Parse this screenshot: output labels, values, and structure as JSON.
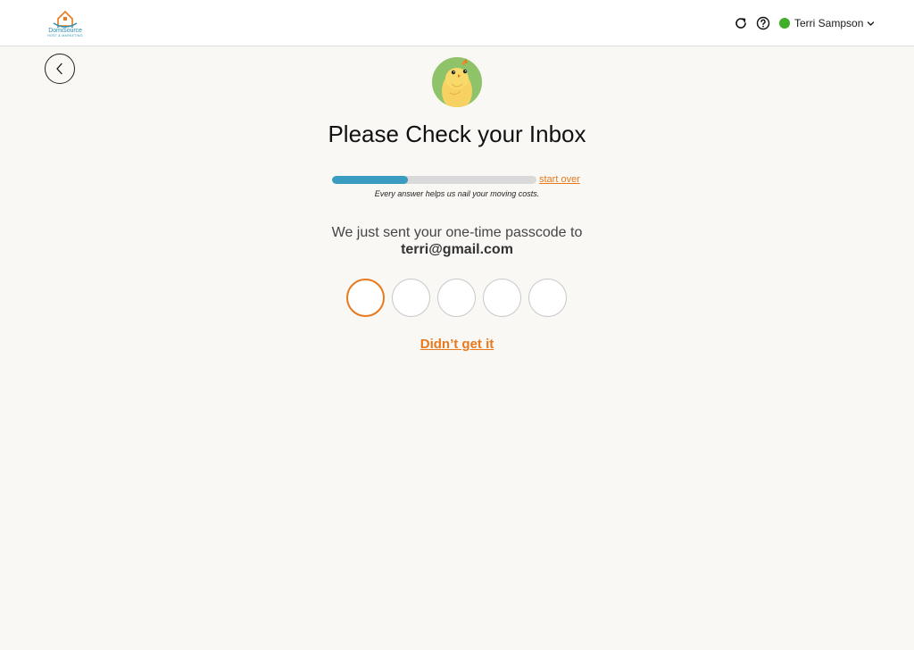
{
  "header": {
    "logo_name": "DomiSource",
    "logo_tagline": "HOST & MARKETING",
    "user_name": "Terri Sampson",
    "status_color": "#3fae2a",
    "icons": [
      "refresh-icon",
      "help-icon",
      "chevron-down-icon"
    ]
  },
  "main": {
    "title": "Please Check your Inbox",
    "progress_fraction": 0.37,
    "start_over_label": "start over",
    "progress_note": "Every answer helps us nail your moving costs.",
    "sent_text": "We just sent your one-time passcode to",
    "email": "terri@gmail.com",
    "otp_count": 5,
    "resend_label": "Didn’t get it"
  },
  "colors": {
    "accent": "#e8791c",
    "progress": "#3a9cc0",
    "background": "#f9f8f5"
  }
}
